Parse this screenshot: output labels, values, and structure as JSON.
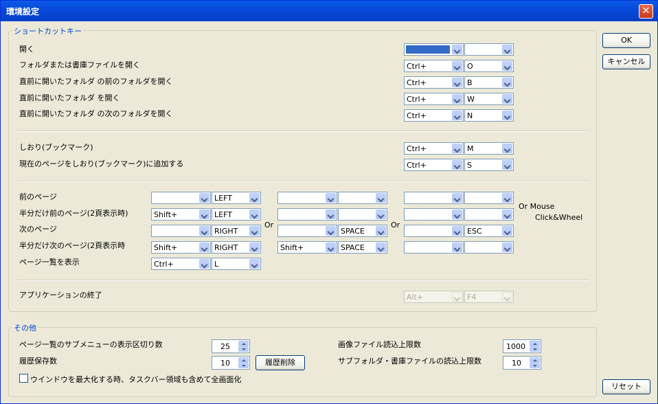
{
  "window": {
    "title": "環境設定",
    "close_icon": "close-icon"
  },
  "buttons": {
    "ok": "OK",
    "cancel": "キャンセル",
    "reset": "リセット",
    "clear_history": "履歴削除"
  },
  "shortcuts": {
    "legend": "ショートカットキー",
    "open": {
      "label": "開く",
      "mod": "",
      "key": ""
    },
    "open_folder": {
      "label": "フォルダまたは書庫ファイルを開く",
      "mod": "Ctrl+",
      "key": "O"
    },
    "open_prev_prev": {
      "label": "直前に開いたフォルダ の前のフォルダを開く",
      "mod": "Ctrl+",
      "key": "B"
    },
    "open_prev": {
      "label": "直前に開いたフォルダ を開く",
      "mod": "Ctrl+",
      "key": "W"
    },
    "open_next": {
      "label": "直前に開いたフォルダ の次のフォルダを開く",
      "mod": "Ctrl+",
      "key": "N"
    },
    "bookmark": {
      "label": "しおり(ブックマーク)",
      "mod": "Ctrl+",
      "key": "M"
    },
    "add_bookmark": {
      "label": "現在のページをしおり(ブックマーク)に追加する",
      "mod": "Ctrl+",
      "key": "S"
    },
    "prev_page": {
      "label": "前のページ",
      "slots": [
        [
          "",
          "LEFT"
        ],
        [
          "",
          ""
        ],
        [
          "",
          ""
        ]
      ]
    },
    "half_prev_page": {
      "label": "半分だけ前のページ(2頁表示時)",
      "slots": [
        [
          "Shift+",
          "LEFT"
        ],
        [
          "",
          ""
        ],
        [
          "",
          ""
        ]
      ]
    },
    "next_page": {
      "label": "次のページ",
      "slots": [
        [
          "",
          "RIGHT"
        ],
        [
          "",
          "SPACE"
        ],
        [
          "",
          "ESC"
        ]
      ]
    },
    "half_next_page": {
      "label": "半分だけ次のページ(2頁表示時",
      "slots": [
        [
          "Shift+",
          "RIGHT"
        ],
        [
          "Shift+",
          "SPACE"
        ],
        [
          "",
          ""
        ]
      ]
    },
    "page_list": {
      "label": "ページ一覧を表示",
      "mod": "Ctrl+",
      "key": "L"
    },
    "or1": "Or",
    "or2": "Or",
    "or_mouse": "Or Mouse",
    "click_wheel": "Click&Wheel",
    "quit": {
      "label": "アプリケーションの終了",
      "mod": "Alt+",
      "key": "F4"
    }
  },
  "other": {
    "legend": "その他",
    "submenu_label": "ページ一覧のサブメニューの表示区切り数",
    "submenu_value": "25",
    "history_label": "履歴保存数",
    "history_value": "10",
    "image_limit_label": "画像ファイル読込上限数",
    "image_limit_value": "1000",
    "subfolder_limit_label": "サブフォルダ・書庫ファイルの読込上限数",
    "subfolder_limit_value": "10",
    "maximize_label": "ウインドウを最大化する時、タスクバー領域も含めて全画面化",
    "maximize_checked": false
  }
}
